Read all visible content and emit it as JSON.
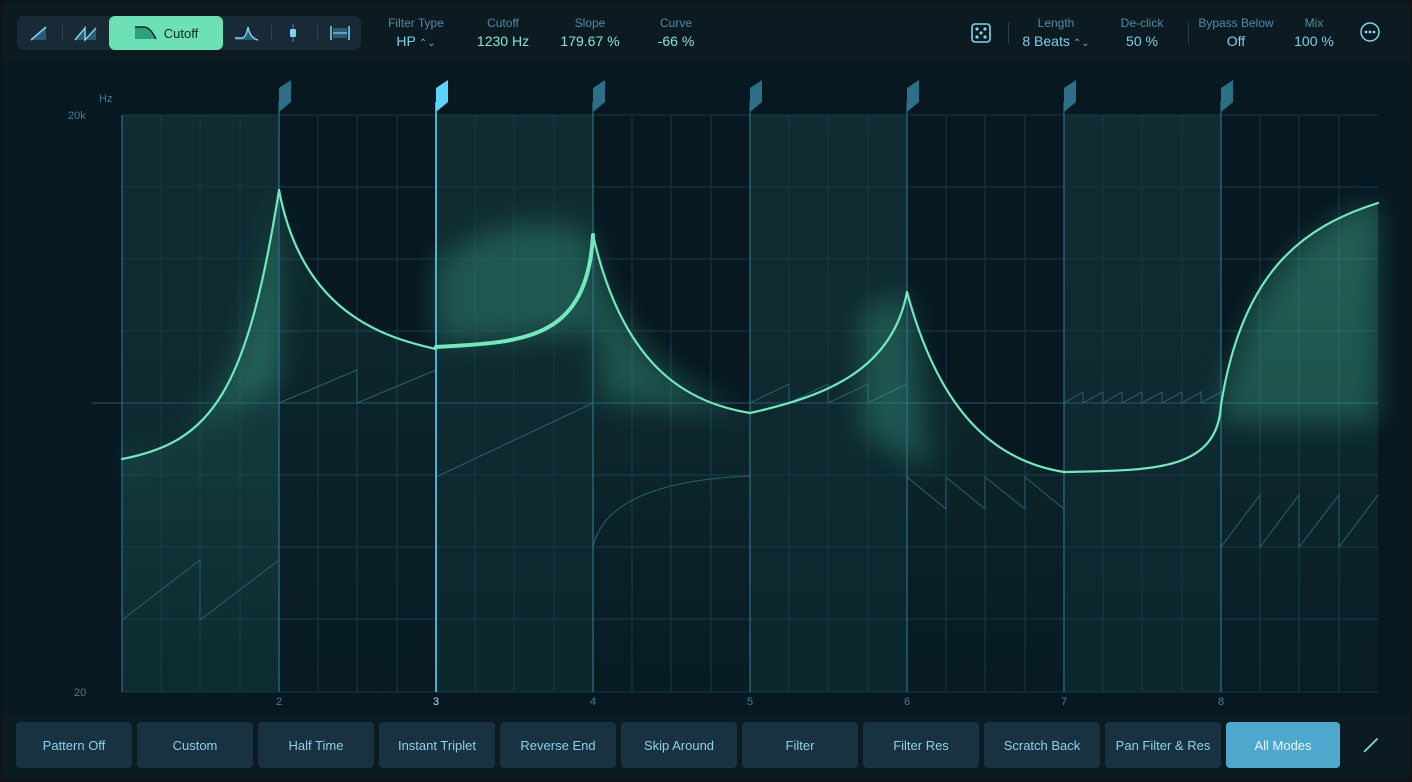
{
  "toolbar": {
    "modes": [
      {
        "icon": "ramp-icon",
        "label": ""
      },
      {
        "icon": "double-ramp-icon",
        "label": ""
      },
      {
        "icon": "filter-cutoff-icon",
        "label": "Cutoff",
        "active": true
      },
      {
        "icon": "filter-resonance-icon",
        "label": ""
      },
      {
        "icon": "pan-icon",
        "label": ""
      },
      {
        "icon": "stretch-icon",
        "label": ""
      }
    ],
    "params": {
      "filter_type": {
        "label": "Filter Type",
        "value": "HP"
      },
      "cutoff": {
        "label": "Cutoff",
        "value": "1230 Hz"
      },
      "slope": {
        "label": "Slope",
        "value": "179.67 %"
      },
      "curve": {
        "label": "Curve",
        "value": "-66 %"
      },
      "length": {
        "label": "Length",
        "value": "8 Beats"
      },
      "declick": {
        "label": "De-click",
        "value": "50 %"
      },
      "bypass_below": {
        "label": "Bypass Below",
        "value": "Off"
      },
      "mix": {
        "label": "Mix",
        "value": "100 %"
      }
    },
    "randomize_icon": "dice-icon",
    "more_icon": "ellipsis-circle-icon"
  },
  "graph": {
    "y_unit": "Hz",
    "y_max_label": "20k",
    "y_min_label": "20",
    "beat_labels": [
      "2",
      "3",
      "4",
      "5",
      "6",
      "7",
      "8"
    ],
    "selected_beat": "3",
    "colors": {
      "curve": "#72e8bd",
      "selected_marker": "#5ed2ff",
      "marker": "#2e6f88",
      "background": "#071821"
    }
  },
  "presets": [
    {
      "label": "Pattern Off"
    },
    {
      "label": "Custom"
    },
    {
      "label": "Half Time"
    },
    {
      "label": "Instant Triplet"
    },
    {
      "label": "Reverse End"
    },
    {
      "label": "Skip Around"
    },
    {
      "label": "Filter"
    },
    {
      "label": "Filter Res"
    },
    {
      "label": "Scratch Back"
    },
    {
      "label": "Pan Filter & Res"
    },
    {
      "label": "All Modes",
      "active": true
    }
  ],
  "pencil_icon": "pencil-icon"
}
